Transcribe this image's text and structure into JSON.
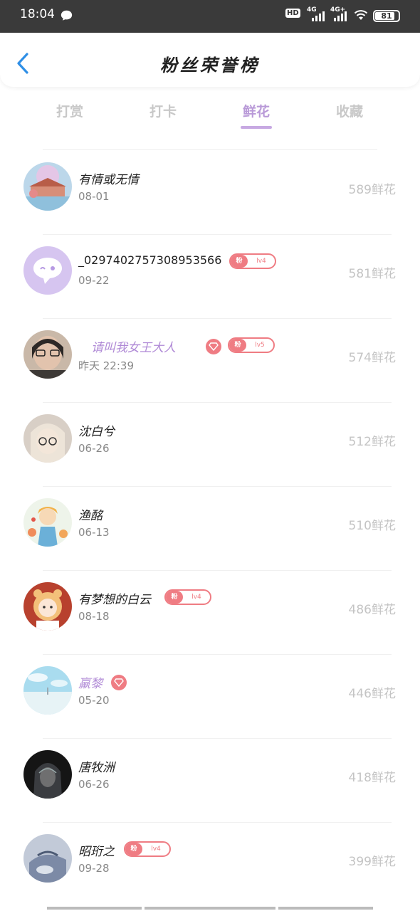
{
  "status": {
    "time": "18:04",
    "hd": "HD",
    "net1": "4G",
    "net2": "4G+",
    "battery": "81"
  },
  "header": {
    "title": "粉丝荣誉榜"
  },
  "tabs": [
    {
      "label": "打赏"
    },
    {
      "label": "打卡"
    },
    {
      "label": "鲜花"
    },
    {
      "label": "收藏"
    }
  ],
  "colors": {
    "accent": "#c7a9e2",
    "badge": "#ef7c83"
  },
  "rows": [
    {
      "name": "有情或无情",
      "date": "08-01",
      "flowers": "589鲜花",
      "avatar": "landscape"
    },
    {
      "name": "_0297402757308953566",
      "date": "09-22",
      "flowers": "581鲜花",
      "badge": "lv4",
      "badge_fan": "粉",
      "avatar": "chat"
    },
    {
      "name": "请叫我女王大人",
      "date": "昨天 22:39",
      "flowers": "574鲜花",
      "badge": "lv5",
      "badge_fan": "粉",
      "vip": true,
      "avatar": "person-glasses"
    },
    {
      "name": "沈白兮",
      "date": "06-26",
      "flowers": "512鲜花",
      "avatar": "anime-glasses"
    },
    {
      "name": "渔酩",
      "date": "06-13",
      "flowers": "510鲜花",
      "avatar": "anime-boy"
    },
    {
      "name": "有梦想的白云",
      "date": "08-18",
      "flowers": "486鲜花",
      "badge": "lv4",
      "badge_fan": "粉",
      "avatar": "tiger-kid"
    },
    {
      "name": "羸黎",
      "date": "05-20",
      "flowers": "446鲜花",
      "vip": true,
      "avatar": "sky"
    },
    {
      "name": "唐牧洲",
      "date": "06-26",
      "flowers": "418鲜花",
      "avatar": "dark"
    },
    {
      "name": "昭珩之",
      "date": "09-28",
      "flowers": "399鲜花",
      "badge": "lv4",
      "badge_fan": "粉",
      "avatar": "water"
    }
  ]
}
